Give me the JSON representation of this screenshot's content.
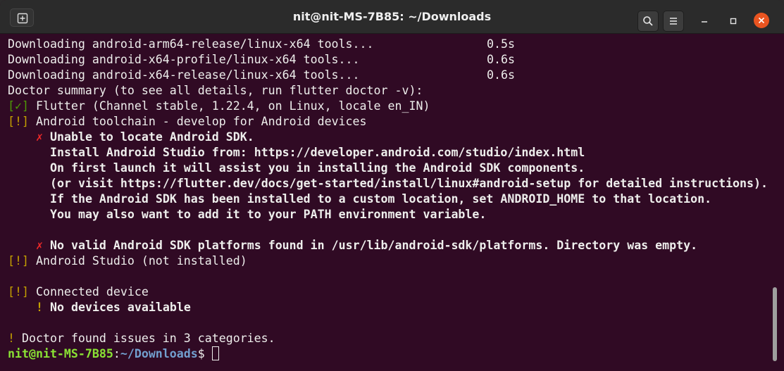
{
  "window": {
    "title": "nit@nit-MS-7B85: ~/Downloads"
  },
  "colors": {
    "terminal_bg": "#300a24",
    "titlebar_bg": "#2b2b2b",
    "close_button": "#e95420",
    "warning_yellow": "#c4a000",
    "ok_green": "#4e9a06",
    "error_red": "#ef2929",
    "prompt_user_green": "#8ae234",
    "prompt_path_blue": "#729fcf"
  },
  "icons": {
    "new_tab": "new-tab-icon",
    "search": "search-icon",
    "menu": "hamburger-menu-icon",
    "minimize": "minimize-icon",
    "maximize": "maximize-icon",
    "close": "close-icon"
  },
  "terminal": {
    "download_lines": [
      {
        "text": "Downloading android-arm64-release/linux-x64 tools...",
        "time": "0.5s"
      },
      {
        "text": "Downloading android-x64-profile/linux-x64 tools...",
        "time": "0.6s"
      },
      {
        "text": "Downloading android-x64-release/linux-x64 tools...",
        "time": "0.6s"
      }
    ],
    "summary_header": "Doctor summary (to see all details, run flutter doctor -v):",
    "flutter": {
      "mark": "[✓]",
      "text": " Flutter (Channel stable, 1.22.4, on Linux, locale en_IN)"
    },
    "toolchain": {
      "mark": "[!]",
      "text": " Android toolchain - develop for Android devices"
    },
    "sdk_error": {
      "mark": "✗",
      "lines": [
        "Unable to locate Android SDK.",
        "Install Android Studio from: https://developer.android.com/studio/index.html",
        "On first launch it will assist you in installing the Android SDK components.",
        "(or visit https://flutter.dev/docs/get-started/install/linux#android-setup for detailed instructions).",
        "If the Android SDK has been installed to a custom location, set ANDROID_HOME to that location.",
        "You may also want to add it to your PATH environment variable."
      ]
    },
    "platform_error": {
      "mark": "✗",
      "text": "No valid Android SDK platforms found in /usr/lib/android-sdk/platforms. Directory was empty."
    },
    "studio": {
      "mark": "[!]",
      "text": " Android Studio (not installed)"
    },
    "device": {
      "mark": "[!]",
      "text": " Connected device"
    },
    "no_devices": {
      "mark": "!",
      "text": "No devices available"
    },
    "issues": {
      "mark": "!",
      "text": " Doctor found issues in 3 categories."
    },
    "prompt": {
      "user_host": "nit@nit-MS-7B85",
      "separator": ":",
      "path": "~/Downloads",
      "symbol": "$ "
    }
  }
}
